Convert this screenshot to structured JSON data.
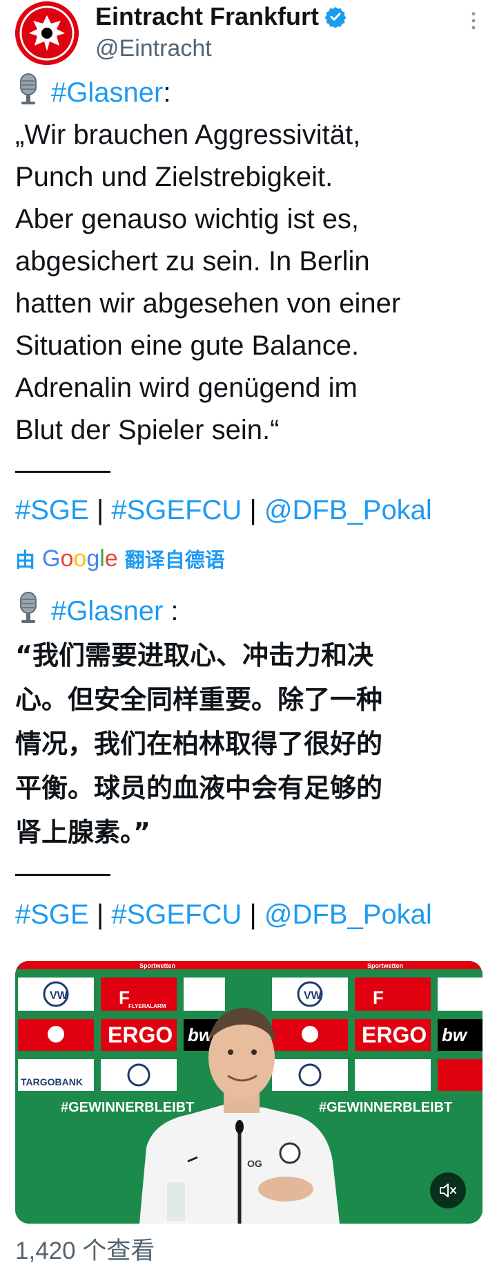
{
  "account": {
    "display_name": "Eintracht Frankfurt",
    "handle": "@Eintracht",
    "verified": true,
    "avatar_icon": "eintracht-eagle-logo"
  },
  "menu_icon": "more-vertical-icon",
  "tweet_de": {
    "mic_icon": "microphone-emoji",
    "hashtag": "#Glasner",
    "colon": ":",
    "lines": [
      "„Wir brauchen Aggressivität,",
      "Punch und Zielstrebigkeit.",
      "Aber genauso wichtig ist es,",
      "abgesichert zu sein. In Berlin",
      "hatten wir abgesehen von einer",
      "Situation eine gute Balance.",
      "Adrenalin wird genügend im",
      "Blut der Spieler sein.“"
    ],
    "tags": [
      "#SGE",
      "#SGEFCU",
      "@DFB_Pokal"
    ],
    "separator": " | "
  },
  "translation_label": {
    "prefix": "由",
    "brand": "Google",
    "suffix": "翻译自德语"
  },
  "tweet_zh": {
    "mic_icon": "microphone-emoji",
    "hashtag": "#Glasner",
    "colon": " :",
    "lines": [
      "“我们需要进取心、冲击力和决",
      "心。但安全同样重要。除了一种",
      "情况，我们在柏林取得了很好的",
      "平衡。球员的血液中会有足够的",
      "肾上腺素。”"
    ],
    "tags": [
      "#SGE",
      "#SGEFCU",
      "@DFB_Pokal"
    ],
    "separator": " | "
  },
  "media": {
    "sponsor_wall": [
      "ERGO",
      "FLYERALARM",
      "TARGOBANK",
      "bwin",
      "#GEWINNERBLEIBT",
      "Sportwetten"
    ],
    "mute_icon": "speaker-muted-icon"
  },
  "views": {
    "count": "1,420",
    "unit": "个查看"
  },
  "colors": {
    "link": "#1d9bf0",
    "text": "#0f1419",
    "secondary": "#536471",
    "club_red": "#e1000f",
    "pitch_green": "#1c8a4a"
  }
}
